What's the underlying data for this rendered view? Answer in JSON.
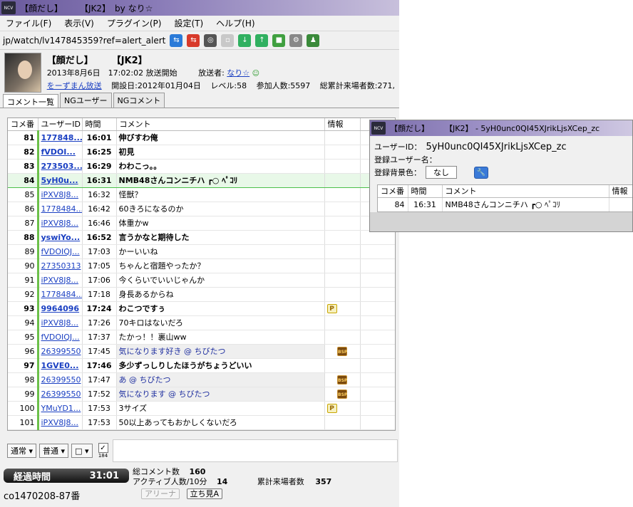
{
  "app_window": {
    "title": "【顔だし】　　　【JK2】　by なり☆",
    "icon_text": "NCV"
  },
  "menu": [
    "ファイル(F)",
    "表示(V)",
    "プラグイン(P)",
    "設定(T)",
    "ヘルプ(H)"
  ],
  "toolbar": {
    "url": "jp/watch/lv147845359?ref=alert_alert"
  },
  "broadcast": {
    "title": "【顔だし】　　　【JK2】",
    "start": "2013年8月6日　17:02:02 放送開始",
    "broadcaster_label": "放送者:",
    "broadcaster_name": "なり☆",
    "community": "をーずまん放送",
    "open_date": "開設日:2012年01月04日",
    "level": "レベル:58",
    "participants": "参加人数:5597",
    "total_visitors": "総累計来場者数:271,"
  },
  "tabs": [
    "コメント一覧",
    "NGユーザー",
    "NGコメント"
  ],
  "columns": [
    "コメ番",
    "ユーザーID",
    "時間",
    "コメント",
    "情報"
  ],
  "comments": [
    {
      "no": "81",
      "uid": "177848...",
      "time": "16:01",
      "text": "伸びすわ俺",
      "info": "",
      "bold": true
    },
    {
      "no": "82",
      "uid": "fVDOI...",
      "time": "16:25",
      "text": "初見",
      "info": "",
      "bold": true
    },
    {
      "no": "83",
      "uid": "273503...",
      "time": "16:29",
      "text": "わわこっ。。",
      "info": "",
      "bold": true
    },
    {
      "no": "84",
      "uid": "5yH0u...",
      "time": "16:31",
      "text": "NMB48さんコンニチハ ┏○ ﾍﾟｺﾘ",
      "info": "",
      "bold": true,
      "selected": true
    },
    {
      "no": "85",
      "uid": "iPXV8J8...",
      "time": "16:32",
      "text": "怪獣？",
      "info": ""
    },
    {
      "no": "86",
      "uid": "1778484...",
      "time": "16:42",
      "text": "60きろになるのか",
      "info": ""
    },
    {
      "no": "87",
      "uid": "iPXV8J8...",
      "time": "16:46",
      "text": "体重かw",
      "info": ""
    },
    {
      "no": "88",
      "uid": "yswiYo...",
      "time": "16:52",
      "text": "言うかなと期待した",
      "info": "",
      "bold": true
    },
    {
      "no": "89",
      "uid": "fVDOIQJ...",
      "time": "17:03",
      "text": "かーいいね",
      "info": ""
    },
    {
      "no": "90",
      "uid": "27350313",
      "time": "17:05",
      "text": "ちゃんと宿題やったか？",
      "info": ""
    },
    {
      "no": "91",
      "uid": "iPXV8J8...",
      "time": "17:06",
      "text": "今くらいでいいじゃんか",
      "info": ""
    },
    {
      "no": "92",
      "uid": "1778484...",
      "time": "17:18",
      "text": "身長あるからね",
      "info": ""
    },
    {
      "no": "93",
      "uid": "9964096",
      "time": "17:24",
      "text": "わこつですぅ",
      "info": "P",
      "bold": true
    },
    {
      "no": "94",
      "uid": "iPXV8J8...",
      "time": "17:26",
      "text": "70キロはないだろ",
      "info": ""
    },
    {
      "no": "95",
      "uid": "fVDOIQJ...",
      "time": "17:37",
      "text": "たかっ！！裏山ww",
      "info": ""
    },
    {
      "no": "96",
      "uid": "26399550",
      "time": "17:45",
      "text": "気になります好き @ ちびたつ",
      "info": "BSP",
      "gray": true
    },
    {
      "no": "97",
      "uid": "1GVE0...",
      "time": "17:46",
      "text": "多少ずっしりしたほうがちょうどいい",
      "info": "",
      "bold": true
    },
    {
      "no": "98",
      "uid": "26399550",
      "time": "17:47",
      "text": "あ @ ちびたつ",
      "info": "BSP",
      "gray": true
    },
    {
      "no": "99",
      "uid": "26399550",
      "time": "17:52",
      "text": "気になります @ ちびたつ",
      "info": "BSP",
      "gray": true
    },
    {
      "no": "100",
      "uid": "YMuYD1...",
      "time": "17:53",
      "text": "3サイズ",
      "info": "P"
    },
    {
      "no": "101",
      "uid": "iPXV8J8...",
      "time": "17:53",
      "text": "50以上あってもおかしくないだろ",
      "info": ""
    }
  ],
  "input": {
    "mode": "通常",
    "size": "普通",
    "color": "□",
    "check_label": "184"
  },
  "status": {
    "elapsed_label": "経過時間",
    "elapsed_value": "31:01",
    "total_comments_label": "総コメント数",
    "total_comments": "160",
    "active_label": "アクティブ人数/10分",
    "active": "14",
    "visitors_label": "累計来場者数",
    "visitors": "357",
    "arena_button": "アリーナ",
    "standing_button": "立ち見A",
    "community_no": "co1470208-87番"
  },
  "popup": {
    "title": "【顔だし】　　　【JK2】 - 5yH0unc0QI45XJrikLjsXCep_zc",
    "uid_label": "ユーザーID：",
    "uid_value": "5yH0unc0QI45XJrikLjsXCep_zc",
    "username_label": "登録ユーザー名：",
    "bgcolor_label": "登録背景色：",
    "bgcolor_value": "なし",
    "columns": [
      "コメ番",
      "時間",
      "コメント",
      "情報"
    ],
    "row": {
      "no": "84",
      "time": "16:31",
      "text": "NMB48さんコンニチハ ┏○ ﾍﾟｺﾘ",
      "info": ""
    }
  }
}
